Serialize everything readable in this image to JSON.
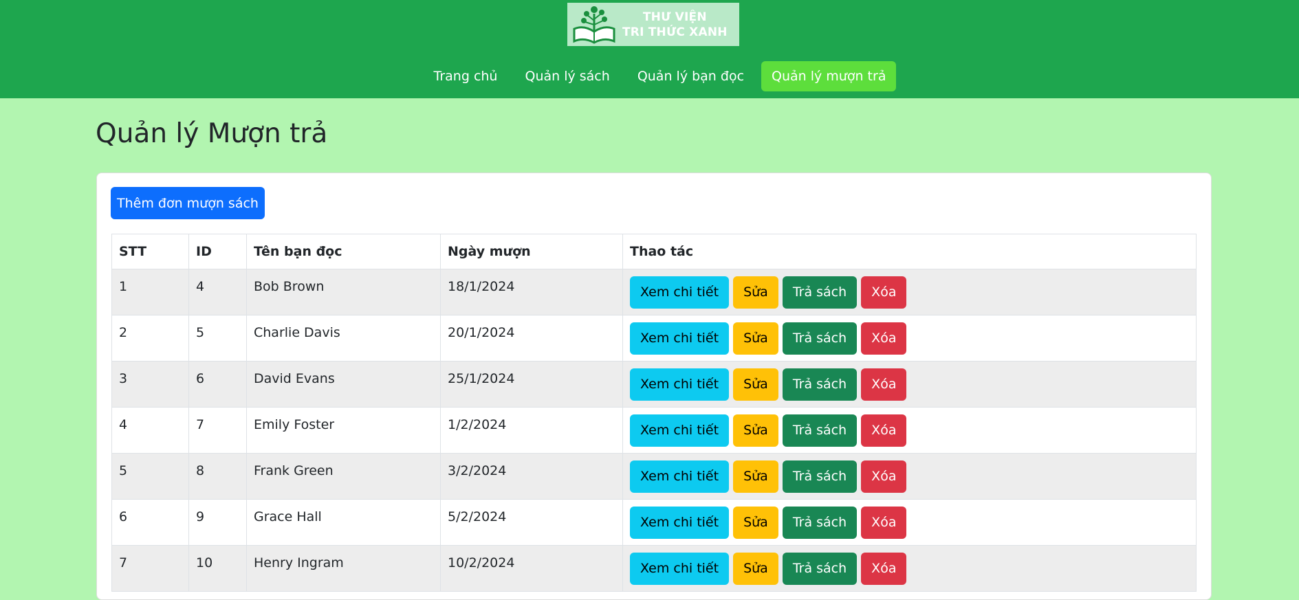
{
  "brand": {
    "line1": "THƯ VIỆN",
    "line2": "TRI THỨC XANH",
    "icon": "book-tree-icon"
  },
  "nav": {
    "items": [
      {
        "label": "Trang chủ"
      },
      {
        "label": "Quản lý sách"
      },
      {
        "label": "Quản lý bạn đọc"
      },
      {
        "label": "Quản lý mượn trả",
        "active": true
      }
    ]
  },
  "page": {
    "title": "Quản lý Mượn trả",
    "add_button": "Thêm đơn mượn sách"
  },
  "table": {
    "headers": [
      "STT",
      "ID",
      "Tên bạn đọc",
      "Ngày mượn",
      "Thao tác"
    ],
    "actions": {
      "view": "Xem chi tiết",
      "edit": "Sửa",
      "return": "Trả sách",
      "delete": "Xóa"
    },
    "rows": [
      {
        "stt": "1",
        "id": "4",
        "name": "Bob Brown",
        "date": "18/1/2024"
      },
      {
        "stt": "2",
        "id": "5",
        "name": "Charlie Davis",
        "date": "20/1/2024"
      },
      {
        "stt": "3",
        "id": "6",
        "name": "David Evans",
        "date": "25/1/2024"
      },
      {
        "stt": "4",
        "id": "7",
        "name": "Emily Foster",
        "date": "1/2/2024"
      },
      {
        "stt": "5",
        "id": "8",
        "name": "Frank Green",
        "date": "3/2/2024"
      },
      {
        "stt": "6",
        "id": "9",
        "name": "Grace Hall",
        "date": "5/2/2024"
      },
      {
        "stt": "7",
        "id": "10",
        "name": "Henry Ingram",
        "date": "10/2/2024"
      }
    ]
  },
  "colors": {
    "header_bg": "#1ea64e",
    "page_bg": "#b2f5b0",
    "nav_active": "#5dde3c",
    "primary": "#0d6efd",
    "info": "#0dcaf0",
    "warning": "#ffc107",
    "success": "#198754",
    "danger": "#dc3545"
  }
}
